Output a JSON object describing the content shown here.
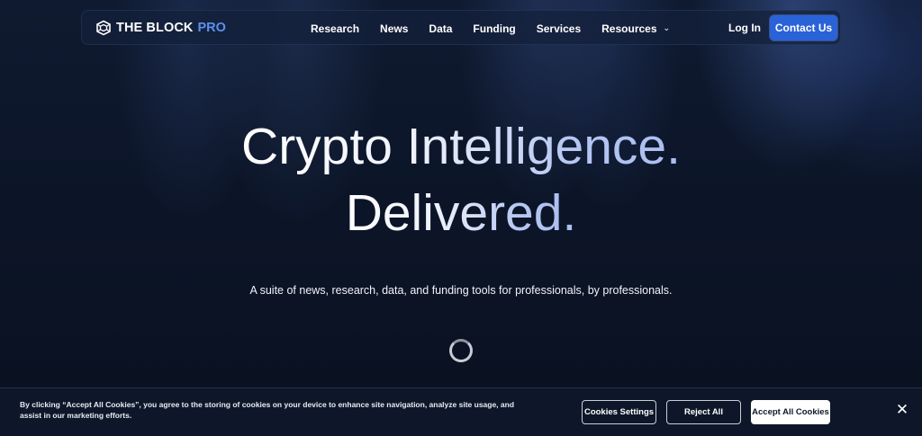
{
  "nav": {
    "logo_text": "THE BLOCK",
    "logo_pro": "PRO",
    "links": [
      "Research",
      "News",
      "Data",
      "Funding",
      "Services",
      "Resources"
    ],
    "login_label": "Log In",
    "contact_label": "Contact Us"
  },
  "hero": {
    "title_line1": "Crypto Intelligence.",
    "title_line2": "Delivered.",
    "subtitle": "A suite of news, research, data, and funding tools for professionals, by professionals."
  },
  "cookie": {
    "text": "By clicking “Accept All Cookies”, you agree to the storing of cookies on your device to enhance site navigation, analyze site usage, and assist in our marketing efforts.",
    "settings_label": "Cookies Settings",
    "reject_label": "Reject All",
    "accept_label": "Accept All Cookies",
    "close_glyph": "✕"
  },
  "colors": {
    "accent": "#2a62d8",
    "logo_pro": "#5d8ff0",
    "background": "#0b1220"
  }
}
